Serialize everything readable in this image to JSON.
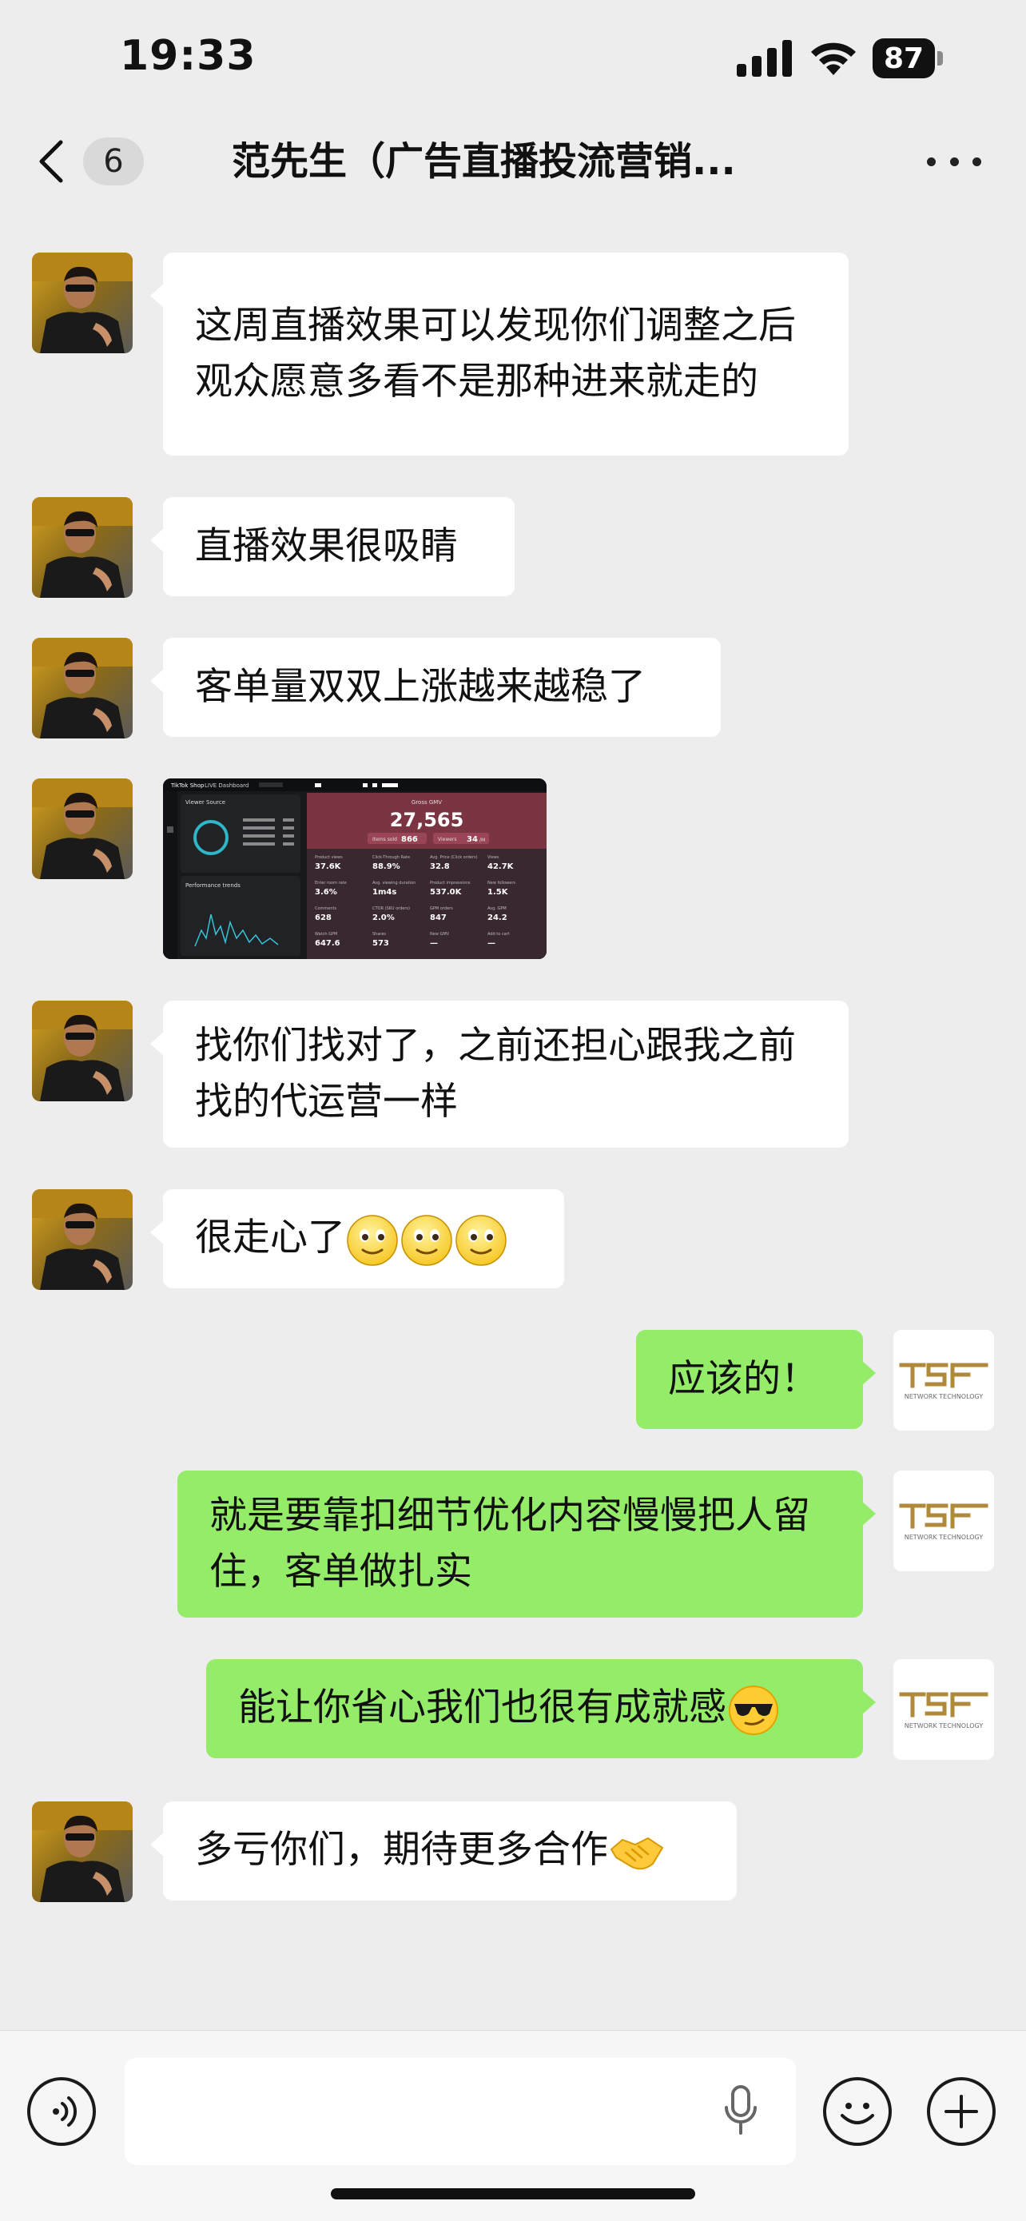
{
  "status_bar": {
    "time": "19:33",
    "battery": "87"
  },
  "header": {
    "back_badge": "6",
    "title": "范先生（广告直播投流营销..."
  },
  "messages": [
    {
      "side": "in",
      "type": "text",
      "text": "这周直播效果可以发现你们调整之后观众愿意多看不是那种进来就走的"
    },
    {
      "side": "in",
      "type": "text",
      "text": "直播效果很吸睛"
    },
    {
      "side": "in",
      "type": "text",
      "text": "客单量双双上涨越来越稳了"
    },
    {
      "side": "in",
      "type": "image",
      "dashboard": {
        "brand": "TikTok Shop",
        "title": "LIVE Dashboard",
        "panel_viewer": "Viewer Source",
        "panel_perf": "Performance trends",
        "headline_label": "Gross GMV",
        "headline_value": "27,565",
        "chip_1_label": "Items sold",
        "chip_1_value": "866",
        "chip_2_label": "Viewers",
        "chip_2_value": "34",
        "chip_2_unit": "/M",
        "metrics": [
          {
            "label": "Product views",
            "value": "37.6K"
          },
          {
            "label": "Click-Through Rate",
            "value": "88.9%"
          },
          {
            "label": "Avg. Price (Click orders)",
            "value": "32.8"
          },
          {
            "label": "Views",
            "value": "42.7K"
          },
          {
            "label": "Enter room rate",
            "value": "3.6%"
          },
          {
            "label": "Avg. viewing duration",
            "value": "1m4s"
          },
          {
            "label": "Product impressions",
            "value": "537.0K"
          },
          {
            "label": "New followers",
            "value": "1.5K"
          },
          {
            "label": "Comments",
            "value": "628"
          },
          {
            "label": "CTOR (SKU orders)",
            "value": "2.0%"
          },
          {
            "label": "GPM orders",
            "value": "847"
          },
          {
            "label": "Avg. GPM",
            "value": "24.2"
          },
          {
            "label": "Watch GPM",
            "value": "647.6"
          },
          {
            "label": "Shares",
            "value": "573"
          },
          {
            "label": "New GMV",
            "value": "—"
          },
          {
            "label": "Add to cart",
            "value": "—"
          }
        ]
      }
    },
    {
      "side": "in",
      "type": "text",
      "text": "找你们找对了，之前还担心跟我之前找的代运营一样"
    },
    {
      "side": "in",
      "type": "text",
      "text": "很走心了",
      "emoji_count": 3,
      "emoji": "slightly-smiling-emoji"
    },
    {
      "side": "out",
      "type": "text",
      "text": "应该的！"
    },
    {
      "side": "out",
      "type": "text",
      "text": "就是要靠扣细节优化内容慢慢把人留住，客单做扎实"
    },
    {
      "side": "out",
      "type": "text",
      "text": "能让你省心我们也很有成就感",
      "emoji": "sunglasses-emoji"
    },
    {
      "side": "in",
      "type": "text",
      "text": "多亏你们，期待更多合作",
      "emoji": "handshake-emoji"
    }
  ],
  "self_avatar": {
    "logo_text": "TSF",
    "logo_sub": "NETWORK TECHNOLOGY",
    "color": "#b08a3a"
  },
  "input": {
    "value": "",
    "placeholder": ""
  },
  "colors": {
    "background": "#ededed",
    "incoming_bubble": "#ffffff",
    "outgoing_bubble": "#95ec69"
  }
}
